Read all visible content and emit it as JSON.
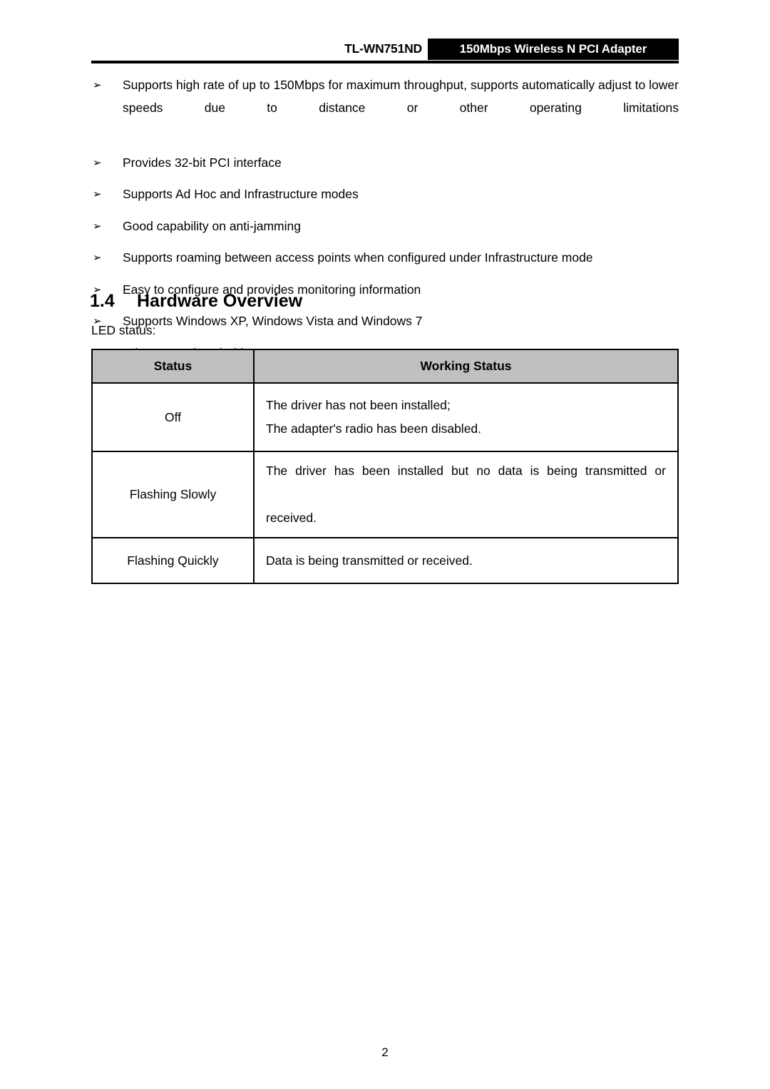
{
  "header": {
    "model": "TL-WN751ND",
    "banner": "150Mbps Wireless N PCI Adapter"
  },
  "features": {
    "bullet_glyph": "➢",
    "items": [
      "Supports high rate of up to 150Mbps for maximum throughput, supports automatically adjust to lower speeds due to distance or other operating limitations",
      "Provides 32-bit PCI interface",
      "Supports Ad Hoc and Infrastructure modes",
      "Good capability on anti-jamming",
      "Supports roaming between access points when configured under Infrastructure mode",
      "Easy to configure and provides monitoring information",
      "Supports Windows XP, Windows Vista and Windows 7",
      "Adopts one detachable antenna"
    ]
  },
  "section": {
    "number": "1.4",
    "title": "Hardware Overview",
    "intro": "LED status:"
  },
  "led_table": {
    "columns": [
      "Status",
      "Working Status"
    ],
    "rows": [
      {
        "status": "Off",
        "description_lines": [
          "The driver has not been installed;",
          "The adapter's radio has been disabled."
        ]
      },
      {
        "status": "Flashing Slowly",
        "description_lines": [
          "The driver has been installed but no data is being transmitted or",
          "received."
        ]
      },
      {
        "status": "Flashing Quickly",
        "description_lines": [
          "Data is being transmitted or received."
        ]
      }
    ]
  },
  "footer": {
    "page_number": "2"
  },
  "colors": {
    "table_header_bg": "#c0c0c0",
    "banner_bg": "#000000",
    "text": "#000000"
  }
}
